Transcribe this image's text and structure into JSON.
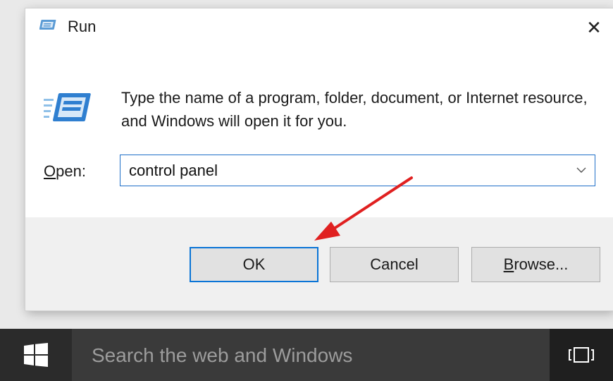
{
  "dialog": {
    "title": "Run",
    "title_icon": "run-icon",
    "close_glyph": "✕",
    "description": "Type the name of a program, folder, document, or Internet resource, and Windows will open it for you.",
    "open_label_accel": "O",
    "open_label_rest": "pen:",
    "input_value": "control panel",
    "dropdown_icon": "chevron-down-icon",
    "buttons": {
      "ok": "OK",
      "cancel": "Cancel",
      "browse_accel": "B",
      "browse_rest": "rowse..."
    }
  },
  "annotation": {
    "arrow_color": "#e02020",
    "points_to": "ok-button"
  },
  "taskbar": {
    "start_icon": "windows-logo-icon",
    "search_placeholder": "Search the web and Windows",
    "task_view_icon": "task-view-icon"
  },
  "colors": {
    "focus_blue": "#0a74d6",
    "taskbar": "#1f1f1f",
    "search_box": "#3a3a3a"
  }
}
